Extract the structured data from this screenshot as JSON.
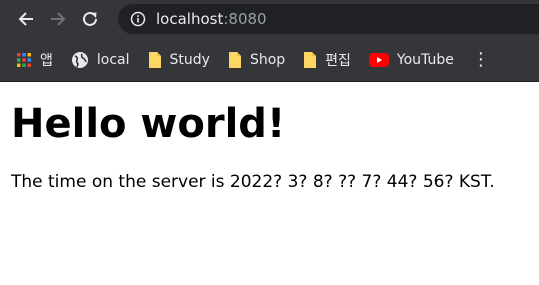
{
  "browser": {
    "address": {
      "host": "localhost",
      "port": ":8080"
    },
    "bookmarks": [
      {
        "label": "앱",
        "icon": "apps-grid-icon"
      },
      {
        "label": "local",
        "icon": "globe-icon"
      },
      {
        "label": "Study",
        "icon": "folder-icon"
      },
      {
        "label": "Shop",
        "icon": "folder-icon"
      },
      {
        "label": "편집",
        "icon": "folder-icon"
      },
      {
        "label": "YouTube",
        "icon": "youtube-icon"
      }
    ]
  },
  "page": {
    "heading": "Hello world!",
    "message": "The time on the server is 2022? 3? 8? ?? 7? 44? 56? KST."
  }
}
